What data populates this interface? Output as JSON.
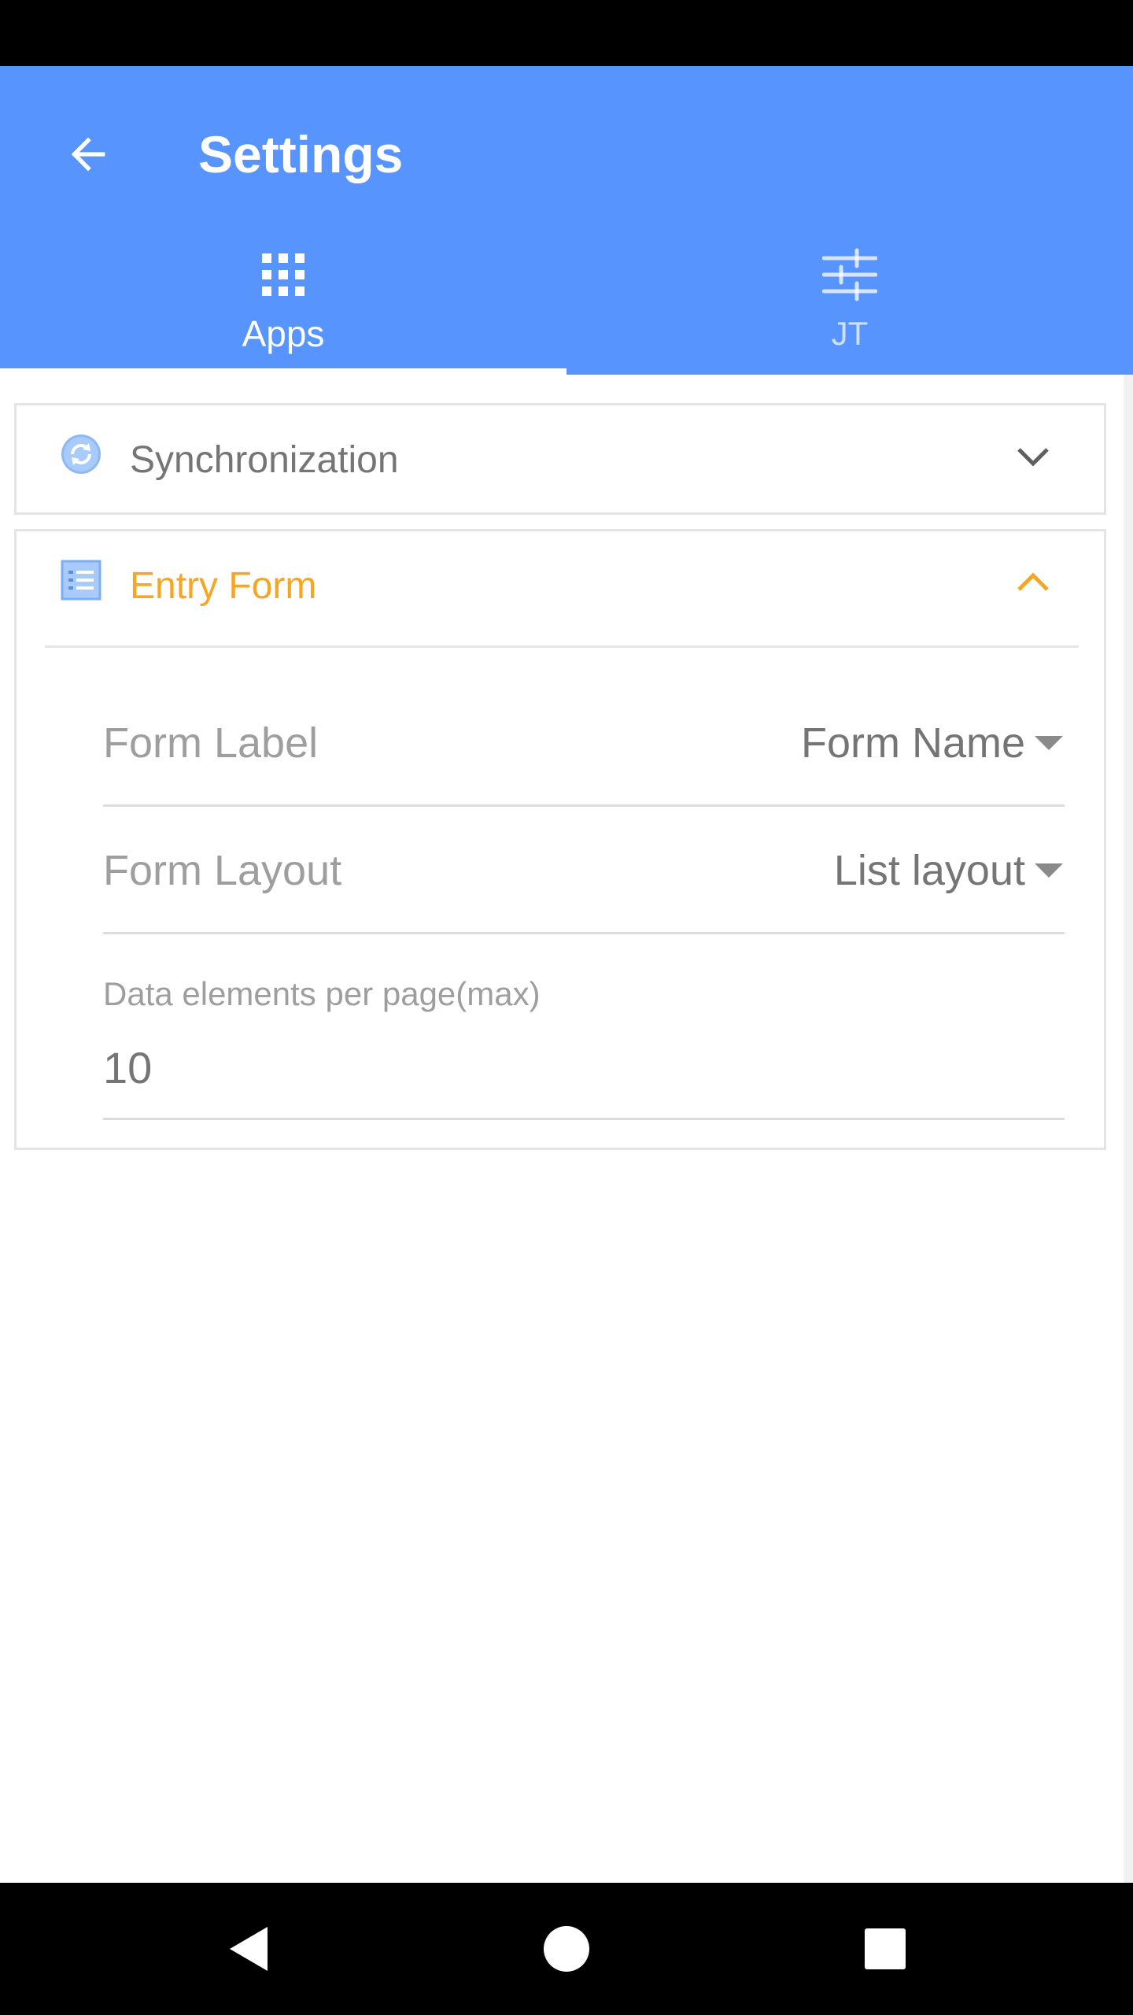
{
  "app_bar": {
    "title": "Settings",
    "back_icon": "arrow-back-icon",
    "color": "#5794fe"
  },
  "tabs": [
    {
      "label": "Apps",
      "icon": "apps-grid-icon",
      "selected": true
    },
    {
      "label": "JT",
      "icon": "sliders-icon",
      "selected": false
    }
  ],
  "sections": {
    "sync": {
      "title": "Synchronization",
      "icon": "sync-icon",
      "expanded": false,
      "chevron": "chevron-down-icon"
    },
    "entry_form": {
      "title": "Entry Form",
      "icon": "form-list-icon",
      "expanded": true,
      "chevron": "chevron-up-icon",
      "accent": "#f5a623",
      "rows": [
        {
          "label": "Form Label",
          "value": "Form Name"
        },
        {
          "label": "Form Layout",
          "value": "List layout"
        }
      ],
      "field": {
        "caption": "Data elements per page(max)",
        "value": "10"
      }
    }
  },
  "navigation": {
    "back": "nav-back-icon",
    "home": "nav-home-icon",
    "recent": "nav-recent-icon"
  }
}
